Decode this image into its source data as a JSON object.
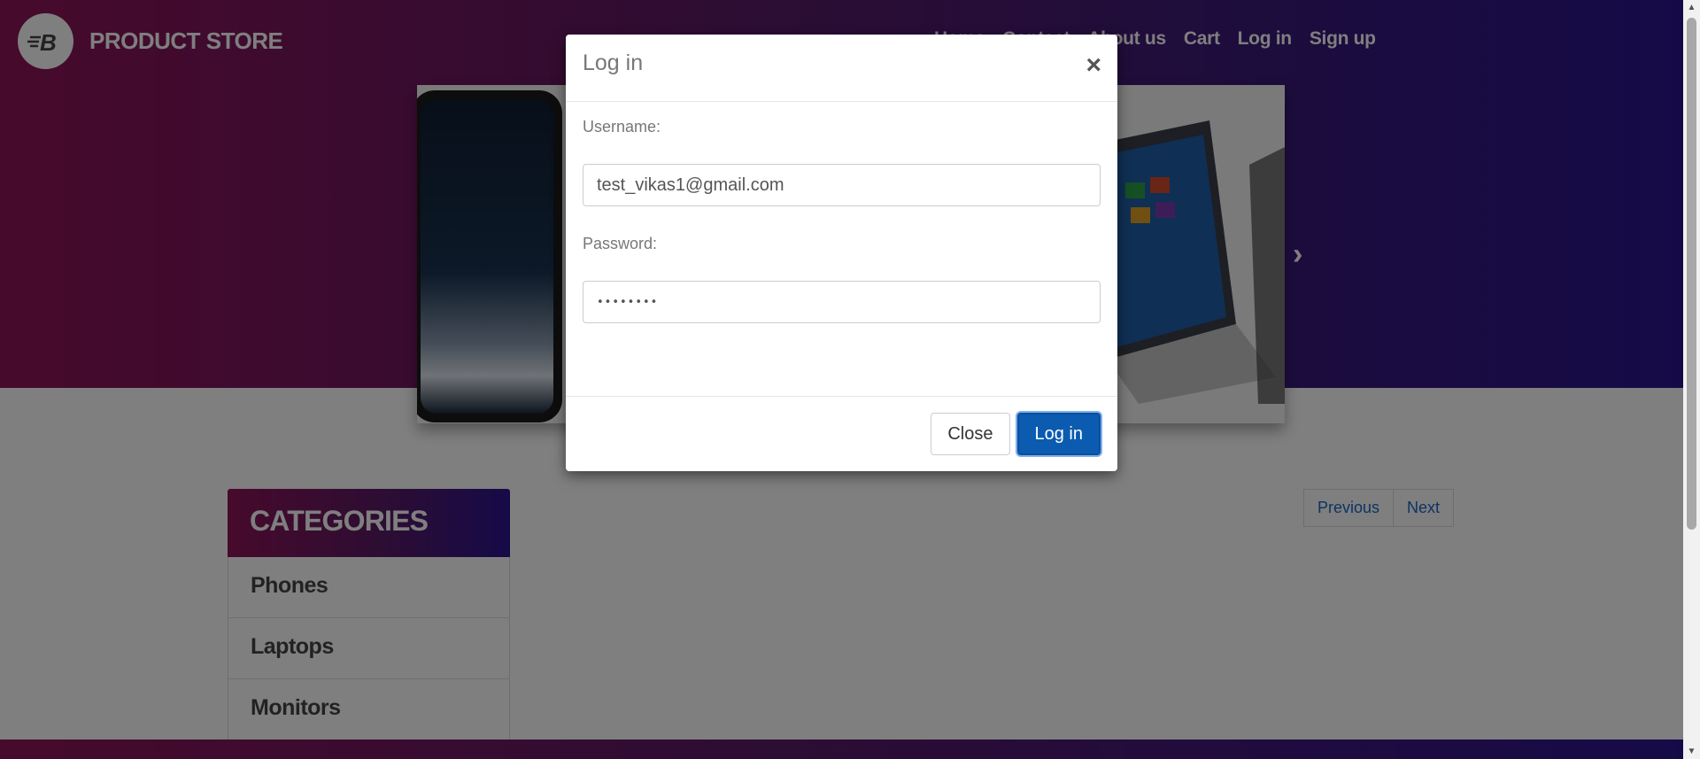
{
  "brand": {
    "name": "PRODUCT STORE",
    "logo_letter": "B"
  },
  "nav": {
    "items": [
      "Home",
      "Contact",
      "About us",
      "Cart",
      "Log in",
      "Sign up"
    ]
  },
  "carousel": {
    "prev_icon": "chevron-left-icon",
    "next_icon": "chevron-right-icon"
  },
  "categories": {
    "title": "CATEGORIES",
    "items": [
      "Phones",
      "Laptops",
      "Monitors"
    ]
  },
  "pager": {
    "previous": "Previous",
    "next": "Next"
  },
  "modal": {
    "title": "Log in",
    "close_glyph": "×",
    "username_label": "Username:",
    "username_value": "test_vikas1@gmail.com",
    "password_label": "Password:",
    "password_value": "••••••••",
    "close_button": "Close",
    "login_button": "Log in"
  },
  "colors": {
    "brand_gradient_start": "#8e1458",
    "brand_gradient_end": "#2b1590",
    "primary_button": "#0b5bb0"
  }
}
